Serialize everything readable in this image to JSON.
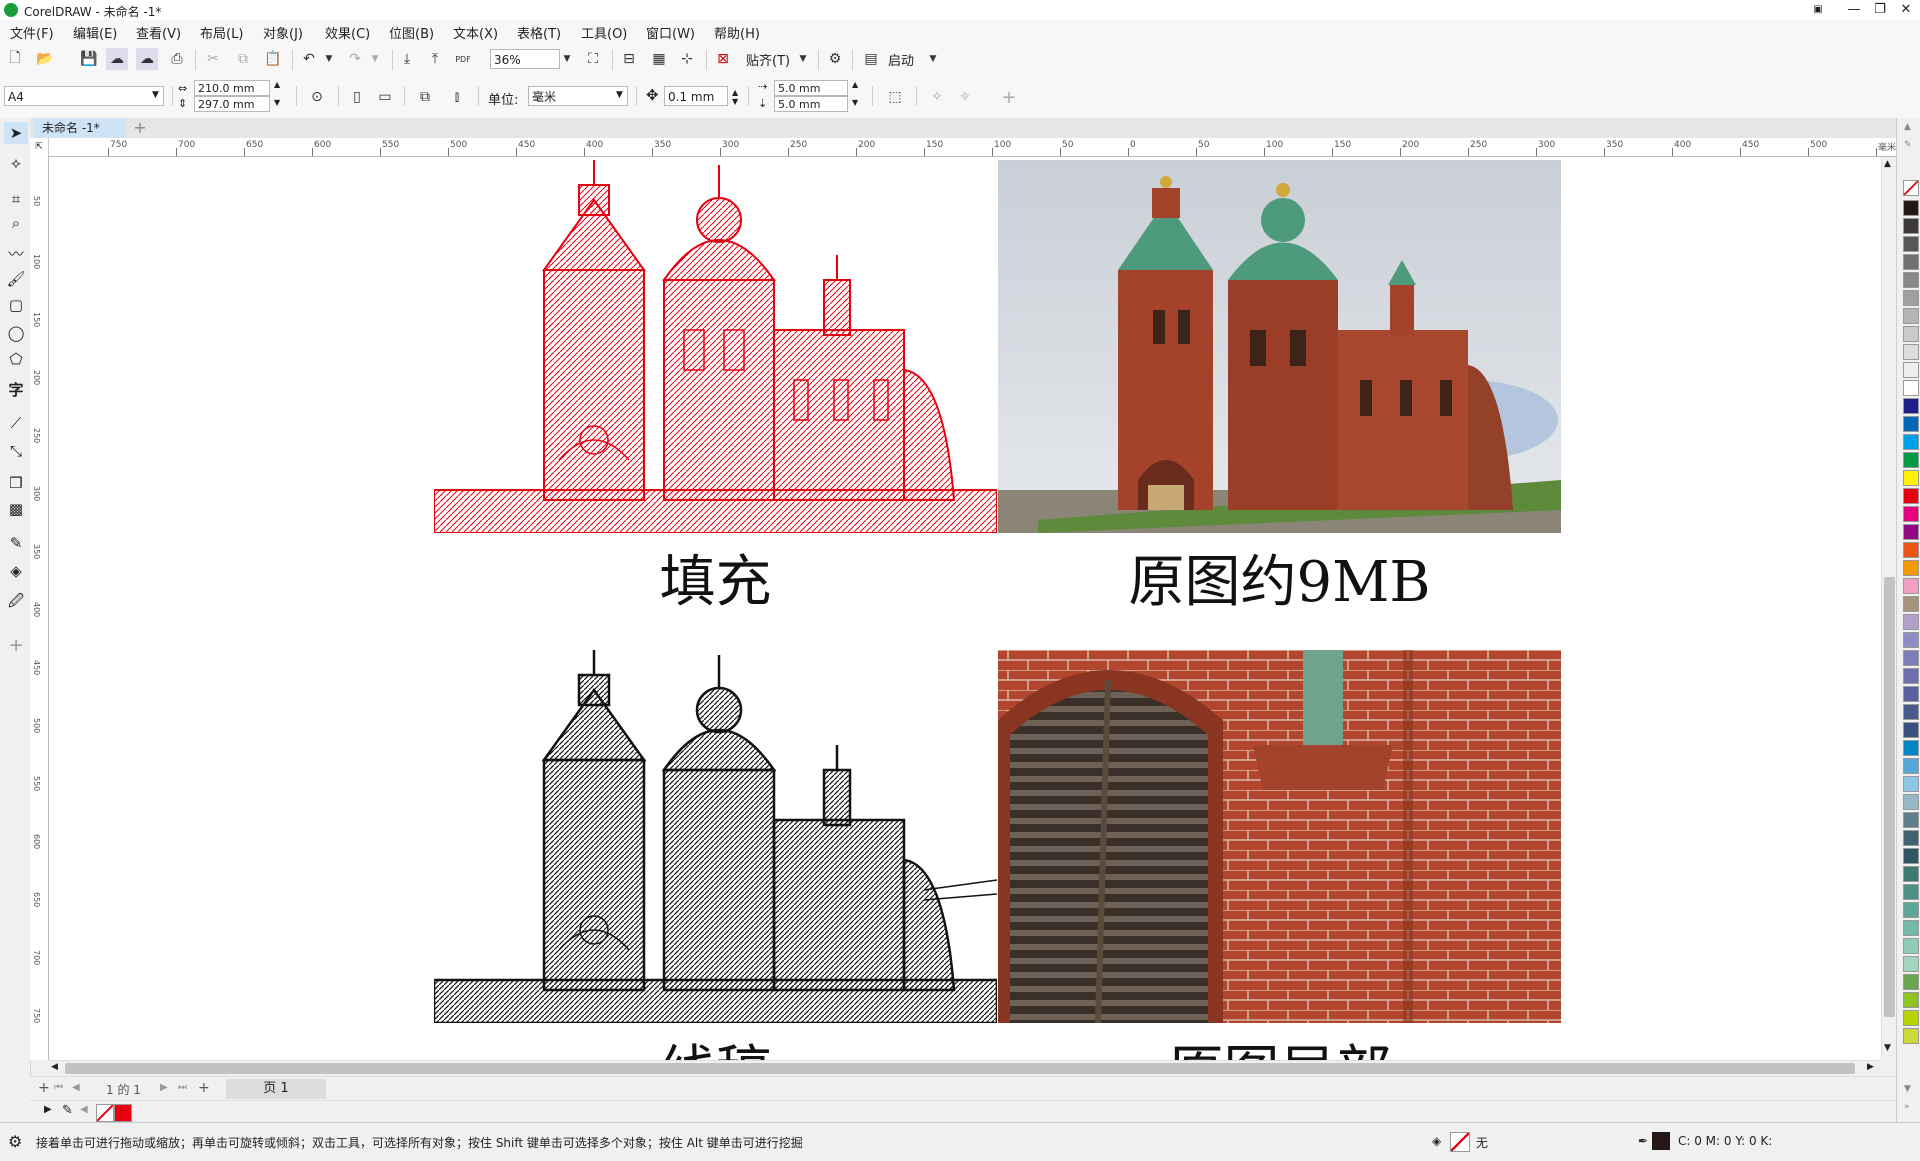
{
  "window": {
    "title": "CorelDRAW - 未命名 -1*"
  },
  "menu": [
    "文件(F)",
    "编辑(E)",
    "查看(V)",
    "布局(L)",
    "对象(J)",
    "效果(C)",
    "位图(B)",
    "文本(X)",
    "表格(T)",
    "工具(O)",
    "窗口(W)",
    "帮助(H)"
  ],
  "toolbar": {
    "zoom": "36%",
    "snap_label": "贴齐(T)",
    "launch_label": "启动",
    "pdf_label": "PDF"
  },
  "propbar": {
    "page_size": "A4",
    "width": "210.0 mm",
    "height": "297.0 mm",
    "unit_label": "单位:",
    "unit_value": "毫米",
    "nudge": "0.1 mm",
    "dup_x": "5.0 mm",
    "dup_y": "5.0 mm"
  },
  "tab": {
    "name": "未命名 -1*"
  },
  "ruler": {
    "h_labels": [
      "750",
      "700",
      "650",
      "600",
      "550",
      "500",
      "450",
      "400",
      "350",
      "300",
      "250",
      "200",
      "150",
      "100",
      "50",
      "0",
      "50",
      "100",
      "150",
      "200",
      "250",
      "300",
      "350",
      "400",
      "450",
      "500",
      "毫米"
    ],
    "v_labels": [
      "50",
      "100",
      "150",
      "200",
      "250",
      "300",
      "350",
      "400",
      "450",
      "500",
      "550",
      "600",
      "650",
      "700",
      "750"
    ]
  },
  "canvas": {
    "captions": {
      "fill": "填充",
      "original": "原图约9MB",
      "lineart": "线稿",
      "detail": "原图局部"
    }
  },
  "pagenav": {
    "page_count": "1 的 1",
    "page_tab": "页 1"
  },
  "status": {
    "hint": "接着单击可进行拖动或缩放；再单击可旋转或倾斜；双击工具，可选择所有对象；按住 Shift 键单击可选择多个对象；按住 Alt 键单击可进行挖掘",
    "fill_label": "无",
    "cmyk": "C: 0 M: 0 Y: 0 K:"
  },
  "palette_colors": [
    "#231815",
    "#3e3a39",
    "#595757",
    "#727171",
    "#898989",
    "#9fa0a0",
    "#b5b5b6",
    "#c9caca",
    "#dcdddd",
    "#efefef",
    "#ffffff",
    "#1d2088",
    "#0068b7",
    "#00a0e9",
    "#009944",
    "#fff100",
    "#e60012",
    "#e4007f",
    "#920783",
    "#ea5514",
    "#f39800",
    "#f19ec2",
    "#a6937c",
    "#b3a0c8",
    "#8c8dc6",
    "#7b7fb8",
    "#6c6fae",
    "#5a5f9f",
    "#4a5a8f",
    "#3a4e80",
    "#0085c7",
    "#56a5d8",
    "#8ec5e6",
    "#98b8c8",
    "#5d7e8c",
    "#3f6470",
    "#2e5561",
    "#3e7a74",
    "#4c9086",
    "#5da597",
    "#74b9a8",
    "#8fcbb8",
    "#a2d4bf",
    "#6aa84f",
    "#8fc31f",
    "#b8d200",
    "#cbd93b"
  ],
  "colors": {
    "accent": "#cfe3f7",
    "selection_red": "#e60012"
  }
}
